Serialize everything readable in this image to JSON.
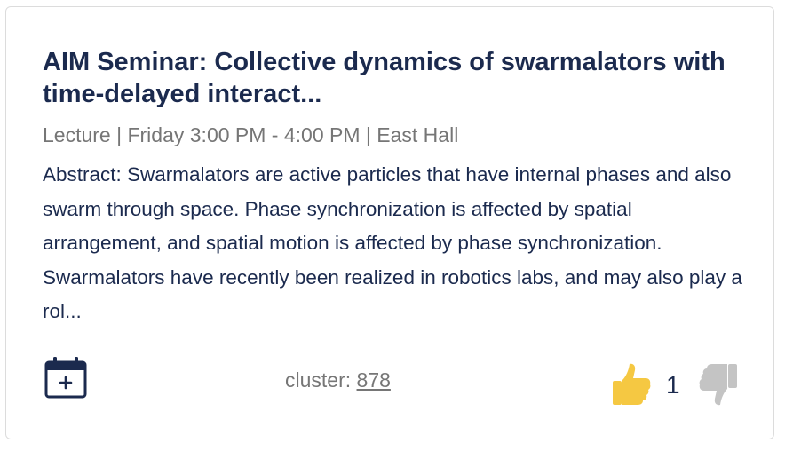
{
  "event": {
    "title": "AIM Seminar: Collective dynamics of swarmalators with time-delayed interact...",
    "meta": "Lecture | Friday 3:00 PM - 4:00 PM | East Hall",
    "abstract": "Abstract: Swarmalators are active particles that have internal phases and also swarm through space. Phase synchronization is affected by spatial arrangement, and spatial motion is affected by phase synchronization. Swarmalators have recently been realized in robotics labs, and may also play a rol..."
  },
  "footer": {
    "calendar_icon": "calendar-add-icon",
    "cluster_label": "cluster: ",
    "cluster_value": "878",
    "upvote_icon": "thumbs-up-icon",
    "vote_count": "1",
    "downvote_icon": "thumbs-down-icon"
  },
  "colors": {
    "title": "#1b2a4e",
    "meta": "#767676",
    "thumb_up": "#f5c842",
    "thumb_down": "#c4c4c4",
    "border": "#dcdcdc"
  }
}
